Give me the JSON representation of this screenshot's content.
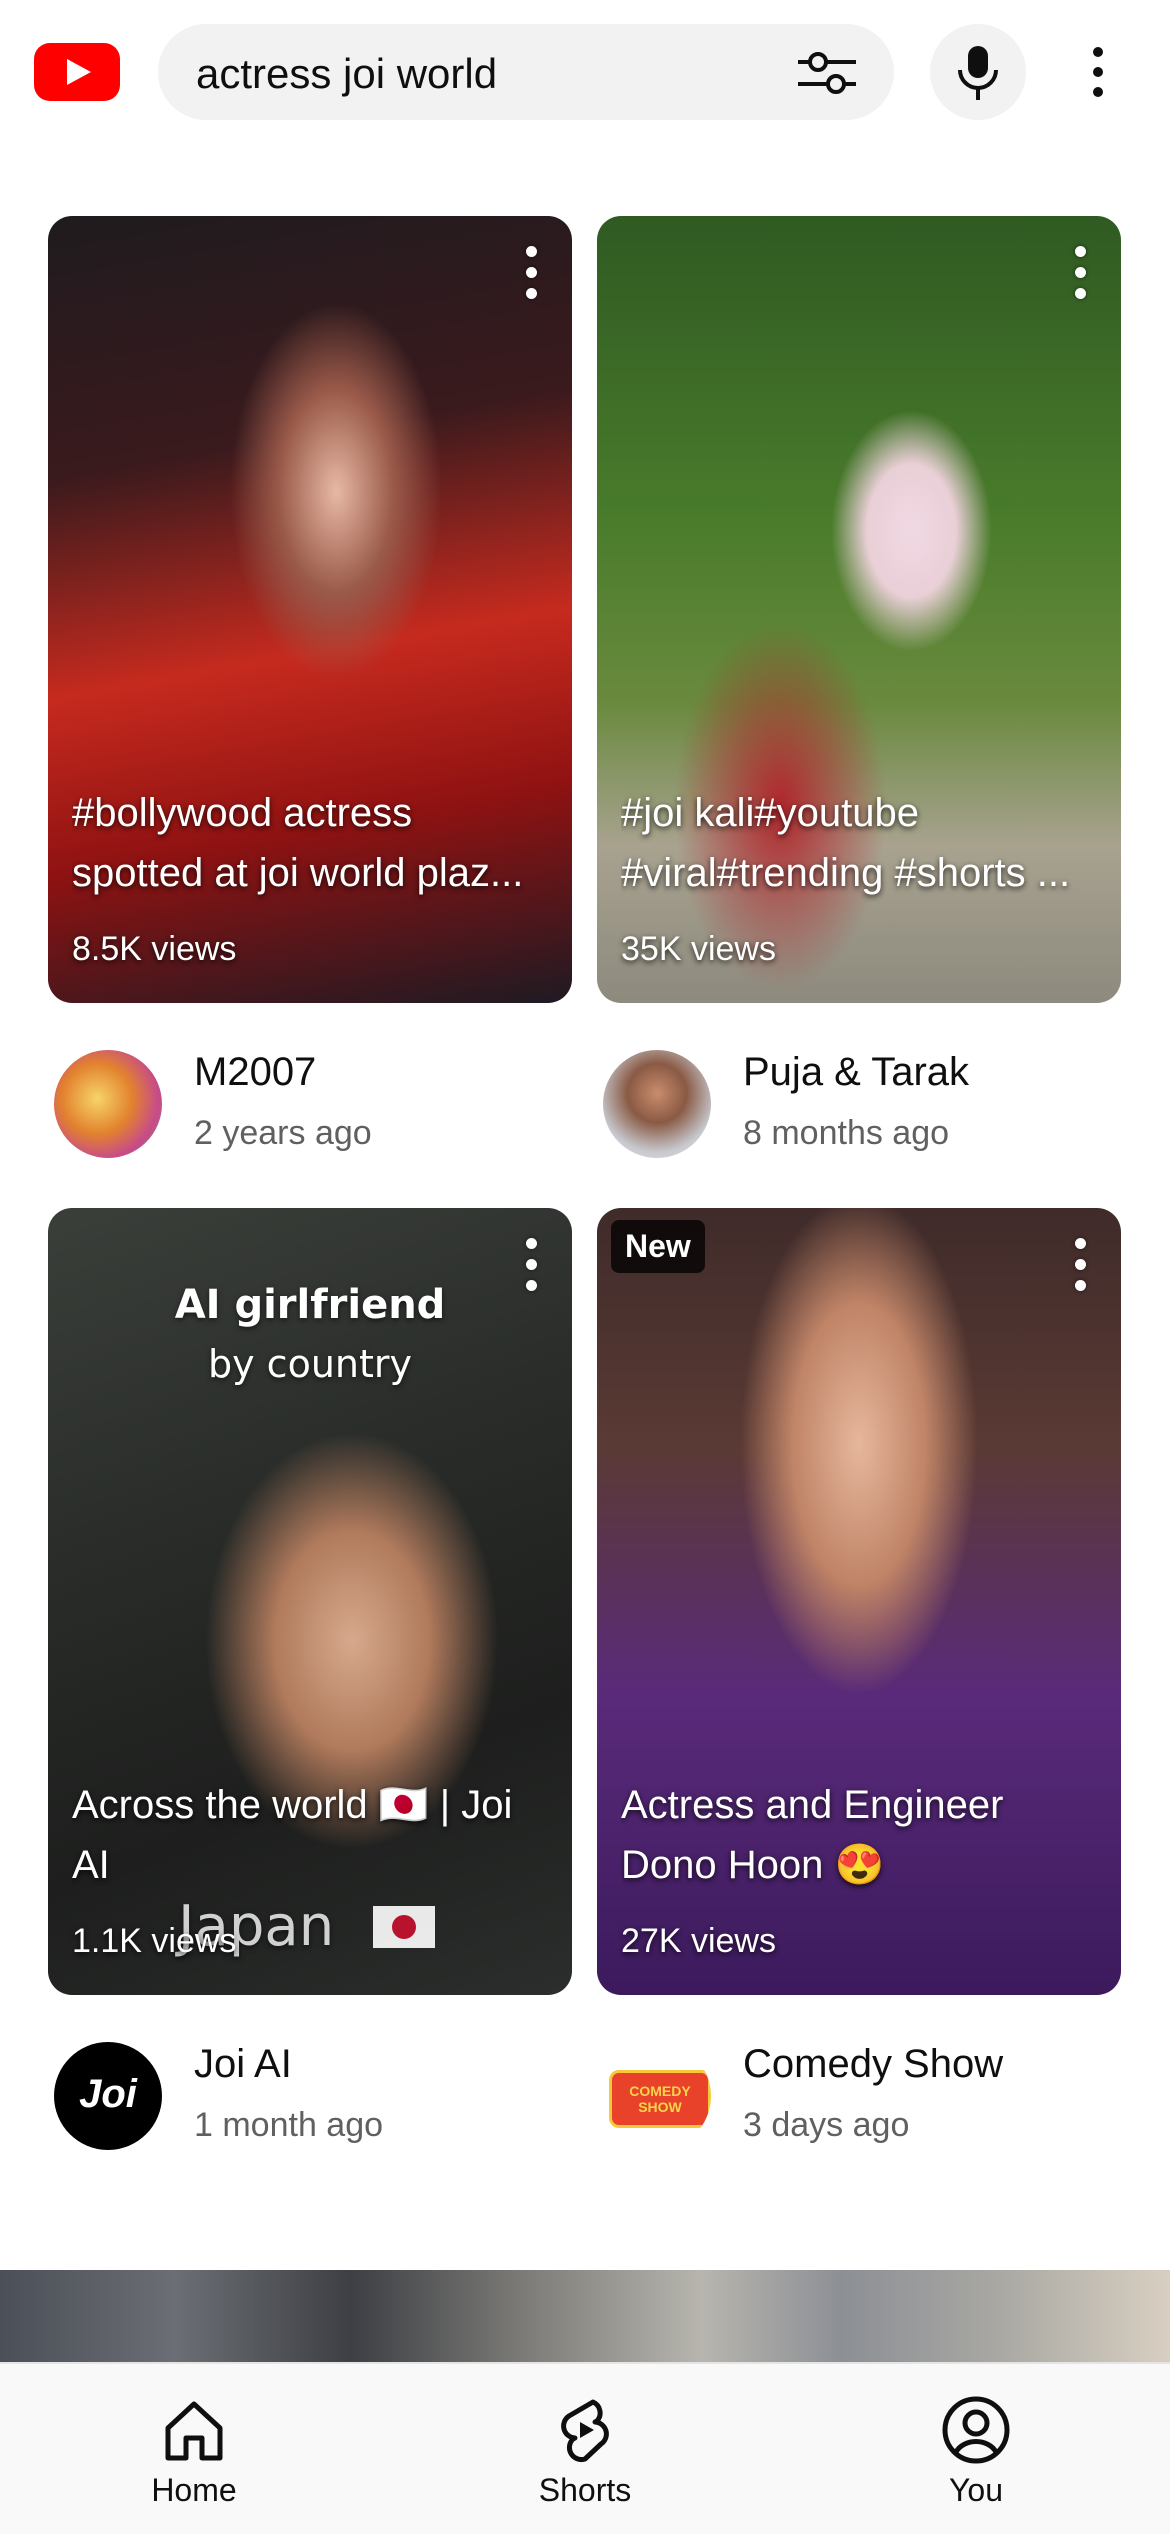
{
  "header": {
    "search_query": "actress joi world",
    "icons": {
      "logo": "youtube-logo-icon",
      "filter": "filter-sliders-icon",
      "mic": "microphone-icon",
      "more": "more-vert-icon"
    },
    "brand_color": "#ff0000"
  },
  "cards": [
    {
      "title_line1": "#bollywood actress",
      "title_line2": "spotted at joi world plaz...",
      "views": "8.5K views",
      "channel": "M2007",
      "time": "2 years ago"
    },
    {
      "title_line1": "#joi kali#youtube",
      "title_line2": "#viral#trending #shorts ...",
      "views": "35K views",
      "channel": "Puja & Tarak",
      "time": "8 months ago"
    },
    {
      "title_line1": "Across the world 🇯🇵 | Joi",
      "title_line2": "AI",
      "views": "1.1K views",
      "channel": "Joi AI",
      "time": "1 month ago",
      "overlay_line1": "AI girlfriend",
      "overlay_line2": "by country",
      "overlay_country": "Japan",
      "avatar_text": "Joi"
    },
    {
      "title_line1": "Actress and Engineer",
      "title_line2": "Dono Hoon 😍",
      "views": "27K views",
      "channel": "Comedy Show",
      "time": "3 days ago",
      "badge": "New",
      "avatar_text": "COMEDY SHOW"
    }
  ],
  "bottom_nav": [
    {
      "label": "Home",
      "icon": "home-icon"
    },
    {
      "label": "Shorts",
      "icon": "shorts-icon"
    },
    {
      "label": "You",
      "icon": "you-account-icon"
    }
  ]
}
